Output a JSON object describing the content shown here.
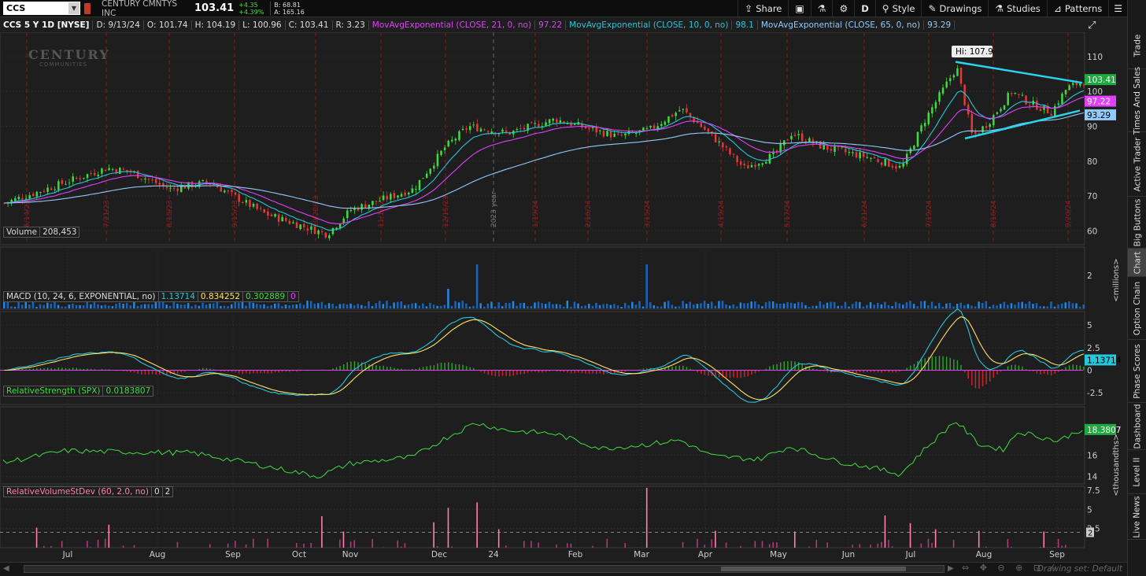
{
  "header": {
    "symbol": "CCS",
    "company": "CENTURY CMNTYS INC",
    "last": "103.41",
    "change": "+4.35",
    "change_pct": "+4.39%",
    "bid": "B: 68.81",
    "ask": "A: 165.16",
    "buttons": {
      "share": "Share",
      "period": "D",
      "style": "Style",
      "drawings": "Drawings",
      "studies": "Studies",
      "patterns": "Patterns"
    }
  },
  "info_bar": {
    "title": "CCS 5 Y 1D [NYSE]",
    "date": "D: 9/13/24",
    "open": "O: 101.74",
    "high": "H: 104.19",
    "low": "L: 100.96",
    "close": "C: 103.41",
    "range": "R: 3.23",
    "ema21_label": "MovAvgExponential (CLOSE, 21, 0, no)",
    "ema21_val": "97.22",
    "ema10_label": "MovAvgExponential (CLOSE, 10, 0, no)",
    "ema10_val": "98.1",
    "ema65_label": "MovAvgExponential (CLOSE, 65, 0, no)",
    "ema65_val": "93.29"
  },
  "watermark": {
    "line1": "CENTURY",
    "line2": "COMMUNITIES"
  },
  "price_pane": {
    "hi_label": "Hi: 107.9",
    "ticks": [
      "110",
      "100",
      "90",
      "80",
      "70",
      "60"
    ],
    "badges": {
      "last": "103.41",
      "ema21": "97.22",
      "ema65": "93.29"
    },
    "date_marks": [
      "6/14/23",
      "7/21/23",
      "8/18/23",
      "9/15/23",
      "10/20/23",
      "11/17/23",
      "12/15/23",
      "2023 year",
      "1/19/24",
      "2/16/24",
      "3/15/24",
      "4/19/24",
      "5/17/24",
      "6/21/24",
      "7/19/24",
      "8/16/24",
      "9/20/24"
    ]
  },
  "volume_pane": {
    "label": "Volume",
    "value": "208,453",
    "ticks": [
      "2"
    ],
    "unit": "<millions>"
  },
  "macd_pane": {
    "label": "MACD (10, 24, 6, EXPONENTIAL, no)",
    "v1": "1.13714",
    "v2": "0.834252",
    "v3": "0.302889",
    "v4": "0",
    "ticks": [
      "5",
      "2.5",
      "0",
      "-2.5"
    ],
    "badge": "1.13714"
  },
  "rs_pane": {
    "label": "RelativeStrength (SPX)",
    "value": "0.0183807",
    "ticks": [
      "16",
      "14"
    ],
    "badge": "18.3807",
    "unit": "<thousandths>"
  },
  "rvsd_pane": {
    "label": "RelativeVolumeStDev (60, 2.0, no)",
    "v1": "0",
    "v2": "2",
    "ticks": [
      "7.5",
      "5",
      "2.5"
    ],
    "badge": "2"
  },
  "x_axis": [
    "Jul",
    "Aug",
    "Sep",
    "Oct",
    "Nov",
    "Dec",
    "24",
    "Feb",
    "Mar",
    "Apr",
    "May",
    "Jun",
    "Jul",
    "Aug",
    "Sep"
  ],
  "sidebar": [
    "Trade",
    "Times And Sales",
    "Active Trader",
    "Big Buttons",
    "Chart",
    "Option Chain",
    "Phase Scores",
    "Dashboard",
    "Level II",
    "Live News"
  ],
  "footer": {
    "drawing_set": "Drawing set: Default"
  },
  "colors": {
    "up": "#3fdc3f",
    "down": "#e53935",
    "ema10": "#26c6da",
    "ema21": "#e040fb",
    "ema65": "#90caf9",
    "trend": "#29d3ee",
    "bg": "#1e1e1e"
  }
}
